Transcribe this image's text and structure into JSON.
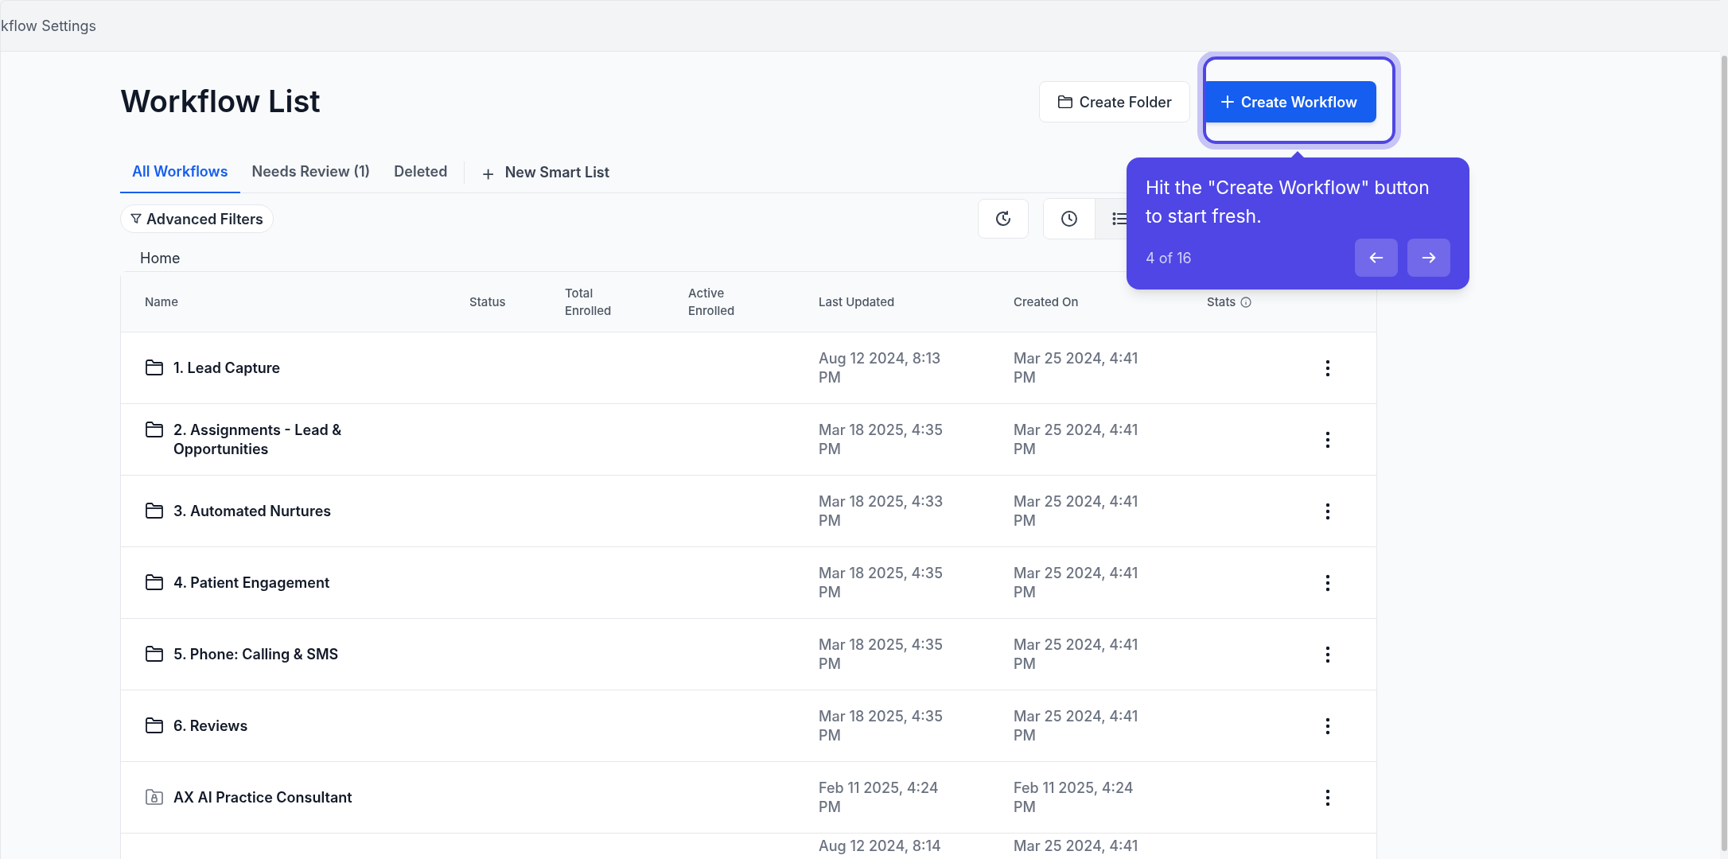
{
  "top_bar": {
    "title": "kflow Settings"
  },
  "page": {
    "title": "Workflow List"
  },
  "actions": [
    {
      "kind": "secondary",
      "label": "Create Folder",
      "highlighted": false
    },
    {
      "kind": "primary",
      "label": "Create Workflow",
      "highlighted": true
    }
  ],
  "tabs": [
    {
      "label": "All Workflows",
      "selected": true
    },
    {
      "label": "Needs Review (1)",
      "selected": false
    },
    {
      "label": "Deleted",
      "selected": false
    }
  ],
  "new_smart_list": {
    "icon": "+",
    "label": "New Smart List"
  },
  "filters": {
    "label": "Advanced Filters"
  },
  "view_toggle": [
    {
      "kind": "clock",
      "selected": false
    },
    {
      "kind": "list",
      "selected": true
    }
  ],
  "breadcrumb": "Home",
  "table": {
    "columns": [
      "Name",
      "Status",
      "Total Enrolled",
      "Active Enrolled",
      "Last Updated",
      "Created On",
      "Stats"
    ],
    "rows": [
      {
        "kind": "folder",
        "name": "1. Lead Capture",
        "last_updated": "Aug 12 2024, 8:13 PM",
        "created_on": "Mar 25 2024, 4:41 PM"
      },
      {
        "kind": "folder",
        "name": "2. Assignments - Lead & Opportunities",
        "last_updated": "Mar 18 2025, 4:35 PM",
        "created_on": "Mar 25 2024, 4:41 PM"
      },
      {
        "kind": "folder",
        "name": "3. Automated Nurtures",
        "last_updated": "Mar 18 2025, 4:33 PM",
        "created_on": "Mar 25 2024, 4:41 PM"
      },
      {
        "kind": "folder",
        "name": "4. Patient Engagement",
        "last_updated": "Mar 18 2025, 4:35 PM",
        "created_on": "Mar 25 2024, 4:41 PM"
      },
      {
        "kind": "folder",
        "name": "5. Phone: Calling & SMS",
        "last_updated": "Mar 18 2025, 4:35 PM",
        "created_on": "Mar 25 2024, 4:41 PM"
      },
      {
        "kind": "folder",
        "name": "6. Reviews",
        "last_updated": "Mar 18 2025, 4:35 PM",
        "created_on": "Mar 25 2024, 4:41 PM"
      },
      {
        "kind": "locked-folder",
        "name": "AX AI Practice Consultant",
        "last_updated": "Feb 11 2025, 4:24 PM",
        "created_on": "Feb 11 2025, 4:24 PM"
      },
      {
        "kind": "partial",
        "last_updated": "Aug 12 2024, 8:14",
        "created_on": "Mar 25 2024, 4:41"
      }
    ]
  },
  "tour_tooltip": {
    "text": "Hit the \"Create Workflow\" button to start fresh.",
    "step": "4 of 16"
  }
}
